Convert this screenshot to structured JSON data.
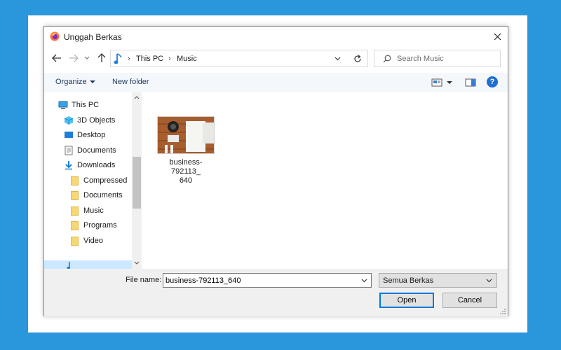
{
  "window": {
    "title": "Unggah Berkas"
  },
  "address": {
    "crumbs": [
      "This PC",
      "Music"
    ]
  },
  "search": {
    "placeholder": "Search Music"
  },
  "toolbar": {
    "organize_label": "Organize",
    "new_folder_label": "New folder"
  },
  "nav": {
    "items": [
      {
        "label": "This PC",
        "icon": "computer-icon"
      },
      {
        "label": "3D Objects",
        "icon": "cube-icon"
      },
      {
        "label": "Desktop",
        "icon": "desktop-icon"
      },
      {
        "label": "Documents",
        "icon": "document-icon"
      },
      {
        "label": "Downloads",
        "icon": "download-icon"
      },
      {
        "label": "Compressed",
        "icon": "folder-icon"
      },
      {
        "label": "Documents",
        "icon": "folder-icon"
      },
      {
        "label": "Music",
        "icon": "folder-icon"
      },
      {
        "label": "Programs",
        "icon": "folder-icon"
      },
      {
        "label": "Video",
        "icon": "folder-icon"
      }
    ]
  },
  "files": [
    {
      "name": "business-792113_640",
      "label_line1": "business-792113_",
      "label_line2": "640"
    }
  ],
  "bottom": {
    "filename_label": "File name:",
    "filename_value": "business-792113_640",
    "filetype_selected": "Semua Berkas",
    "open_label": "Open",
    "cancel_label": "Cancel"
  },
  "colors": {
    "background": "#2a96db",
    "accent": "#0078d7",
    "folder": "#f8d775"
  }
}
